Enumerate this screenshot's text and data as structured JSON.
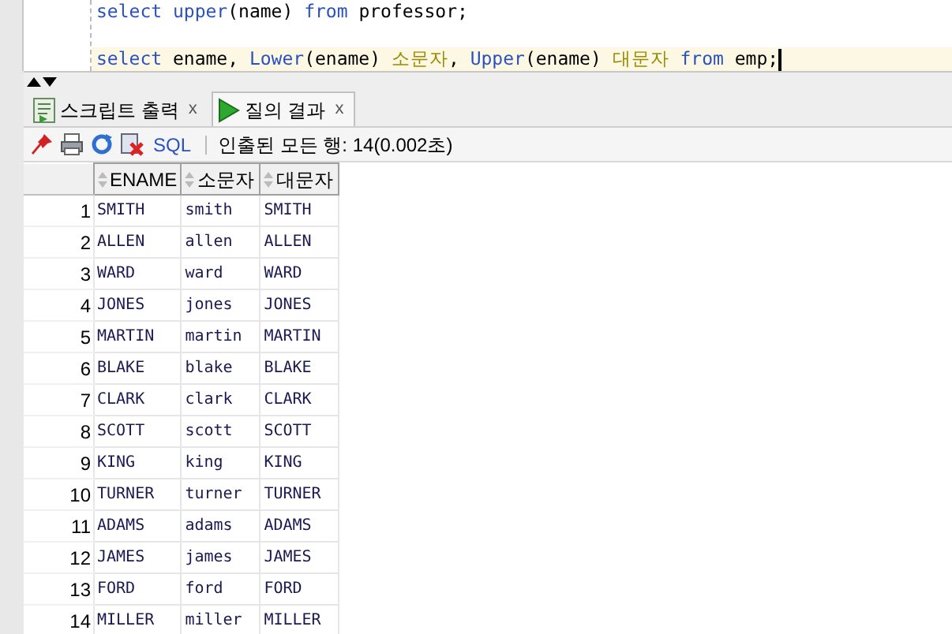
{
  "editor": {
    "lines": [
      {
        "current": false,
        "tokens": [
          {
            "kind": "keyword",
            "text": "select"
          },
          {
            "kind": "function",
            "text": " upper"
          },
          {
            "kind": "plain",
            "text": "(name) "
          },
          {
            "kind": "keyword",
            "text": "from"
          },
          {
            "kind": "plain",
            "text": " professor;"
          }
        ]
      },
      {
        "current": false
      },
      {
        "current": true,
        "tokens": [
          {
            "kind": "keyword",
            "text": "select"
          },
          {
            "kind": "plain",
            "text": " ename, "
          },
          {
            "kind": "function",
            "text": "Lower"
          },
          {
            "kind": "plain",
            "text": "(ename) "
          },
          {
            "kind": "alias",
            "text": "소문자"
          },
          {
            "kind": "plain",
            "text": ", "
          },
          {
            "kind": "function",
            "text": "Upper"
          },
          {
            "kind": "plain",
            "text": "(ename) "
          },
          {
            "kind": "alias",
            "text": "대문자"
          },
          {
            "kind": "keyword",
            "text": " from"
          },
          {
            "kind": "plain",
            "text": " emp;"
          }
        ]
      }
    ]
  },
  "tabs": [
    {
      "label": "스크립트 출력",
      "close": "x",
      "selected": false,
      "kind": "script"
    },
    {
      "label": "질의 결과",
      "close": "x",
      "selected": true,
      "kind": "query"
    }
  ],
  "toolbar": {
    "sql": "SQL",
    "status": "인출된 모든 행: 14(0.002초)"
  },
  "table": {
    "columns": [
      "ENAME",
      "소문자",
      "대문자"
    ],
    "rows": [
      {
        "number": "1",
        "cells": [
          "SMITH",
          "smith",
          "SMITH"
        ]
      },
      {
        "number": "2",
        "cells": [
          "ALLEN",
          "allen",
          "ALLEN"
        ]
      },
      {
        "number": "3",
        "cells": [
          "WARD",
          "ward",
          "WARD"
        ]
      },
      {
        "number": "4",
        "cells": [
          "JONES",
          "jones",
          "JONES"
        ]
      },
      {
        "number": "5",
        "cells": [
          "MARTIN",
          "martin",
          "MARTIN"
        ]
      },
      {
        "number": "6",
        "cells": [
          "BLAKE",
          "blake",
          "BLAKE"
        ]
      },
      {
        "number": "7",
        "cells": [
          "CLARK",
          "clark",
          "CLARK"
        ]
      },
      {
        "number": "8",
        "cells": [
          "SCOTT",
          "scott",
          "SCOTT"
        ]
      },
      {
        "number": "9",
        "cells": [
          "KING",
          "king",
          "KING"
        ]
      },
      {
        "number": "10",
        "cells": [
          "TURNER",
          "turner",
          "TURNER"
        ]
      },
      {
        "number": "11",
        "cells": [
          "ADAMS",
          "adams",
          "ADAMS"
        ]
      },
      {
        "number": "12",
        "cells": [
          "JAMES",
          "james",
          "JAMES"
        ]
      },
      {
        "number": "13",
        "cells": [
          "FORD",
          "ford",
          "FORD"
        ]
      },
      {
        "number": "14",
        "cells": [
          "MILLER",
          "miller",
          "MILLER"
        ]
      }
    ]
  }
}
